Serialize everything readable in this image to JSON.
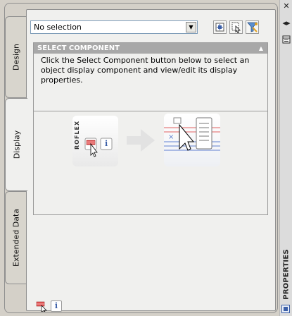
{
  "window": {
    "strip_title": "PROPERTIES",
    "strip_buttons": [
      "close-icon",
      "auto-hide-icon",
      "properties-menu-icon"
    ]
  },
  "tabs": [
    {
      "label": "Design",
      "active": false
    },
    {
      "label": "Display",
      "active": true
    },
    {
      "label": "Extended Data",
      "active": false
    }
  ],
  "toolbar": {
    "selection_value": "No selection",
    "buttons": [
      "toggle-pickadd-icon",
      "select-objects-icon",
      "quick-select-icon"
    ]
  },
  "section": {
    "title": "SELECT COMPONENT",
    "description": "Click the Select Component button below to select an object display component and view/edit its display properties."
  },
  "illustration": {
    "vertical_text": "ROFLEX",
    "info_glyph": "i"
  },
  "bottom": {
    "info_glyph": "i"
  },
  "colors": {
    "panel_bg": "#f0f0ee",
    "header_bg": "#a8a8a8",
    "accent_blue": "#3b5fa8"
  }
}
